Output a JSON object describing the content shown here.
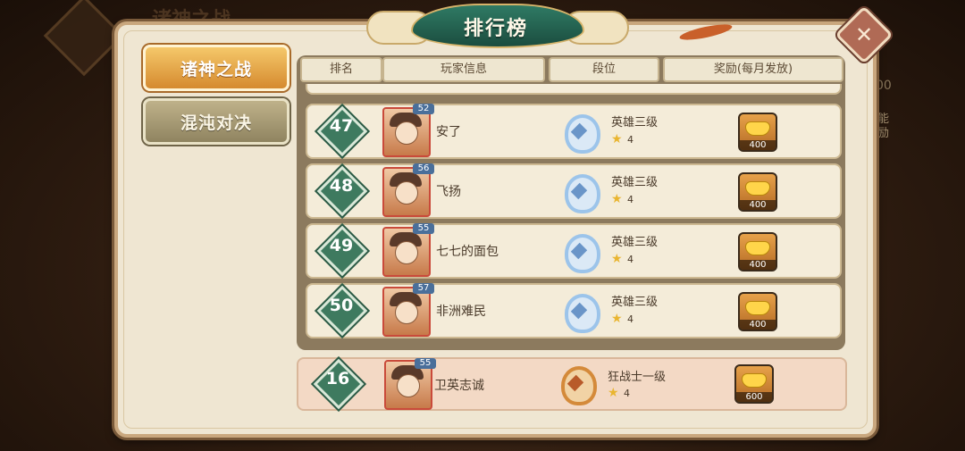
{
  "background": {
    "title": "诸神之战",
    "side_text": "能励",
    "side_number": "00"
  },
  "title": "排行榜",
  "close_label": "✕",
  "tabs": [
    {
      "label": "诸神之战",
      "active": true
    },
    {
      "label": "混沌对决",
      "active": false
    }
  ],
  "headers": {
    "rank": "排名",
    "player": "玩家信息",
    "tier": "段位",
    "reward": "奖励(每月发放)"
  },
  "rows": [
    {
      "rank": "47",
      "level": "52",
      "name": "安了",
      "tier": "英雄三级",
      "stars": "4",
      "reward": "400"
    },
    {
      "rank": "48",
      "level": "56",
      "name": "飞扬",
      "tier": "英雄三级",
      "stars": "4",
      "reward": "400"
    },
    {
      "rank": "49",
      "level": "55",
      "name": "七七的面包",
      "tier": "英雄三级",
      "stars": "4",
      "reward": "400"
    },
    {
      "rank": "50",
      "level": "57",
      "name": "非洲难民",
      "tier": "英雄三级",
      "stars": "4",
      "reward": "400"
    }
  ],
  "self": {
    "rank": "16",
    "level": "55",
    "name": "卫英志诚",
    "tier": "狂战士一级",
    "stars": "4",
    "reward": "600"
  },
  "star_glyph": "★",
  "colors": {
    "rank_green": "#3e7a5f",
    "active_tab": "#d58a2f",
    "panel_bg": "#efe6d2"
  }
}
